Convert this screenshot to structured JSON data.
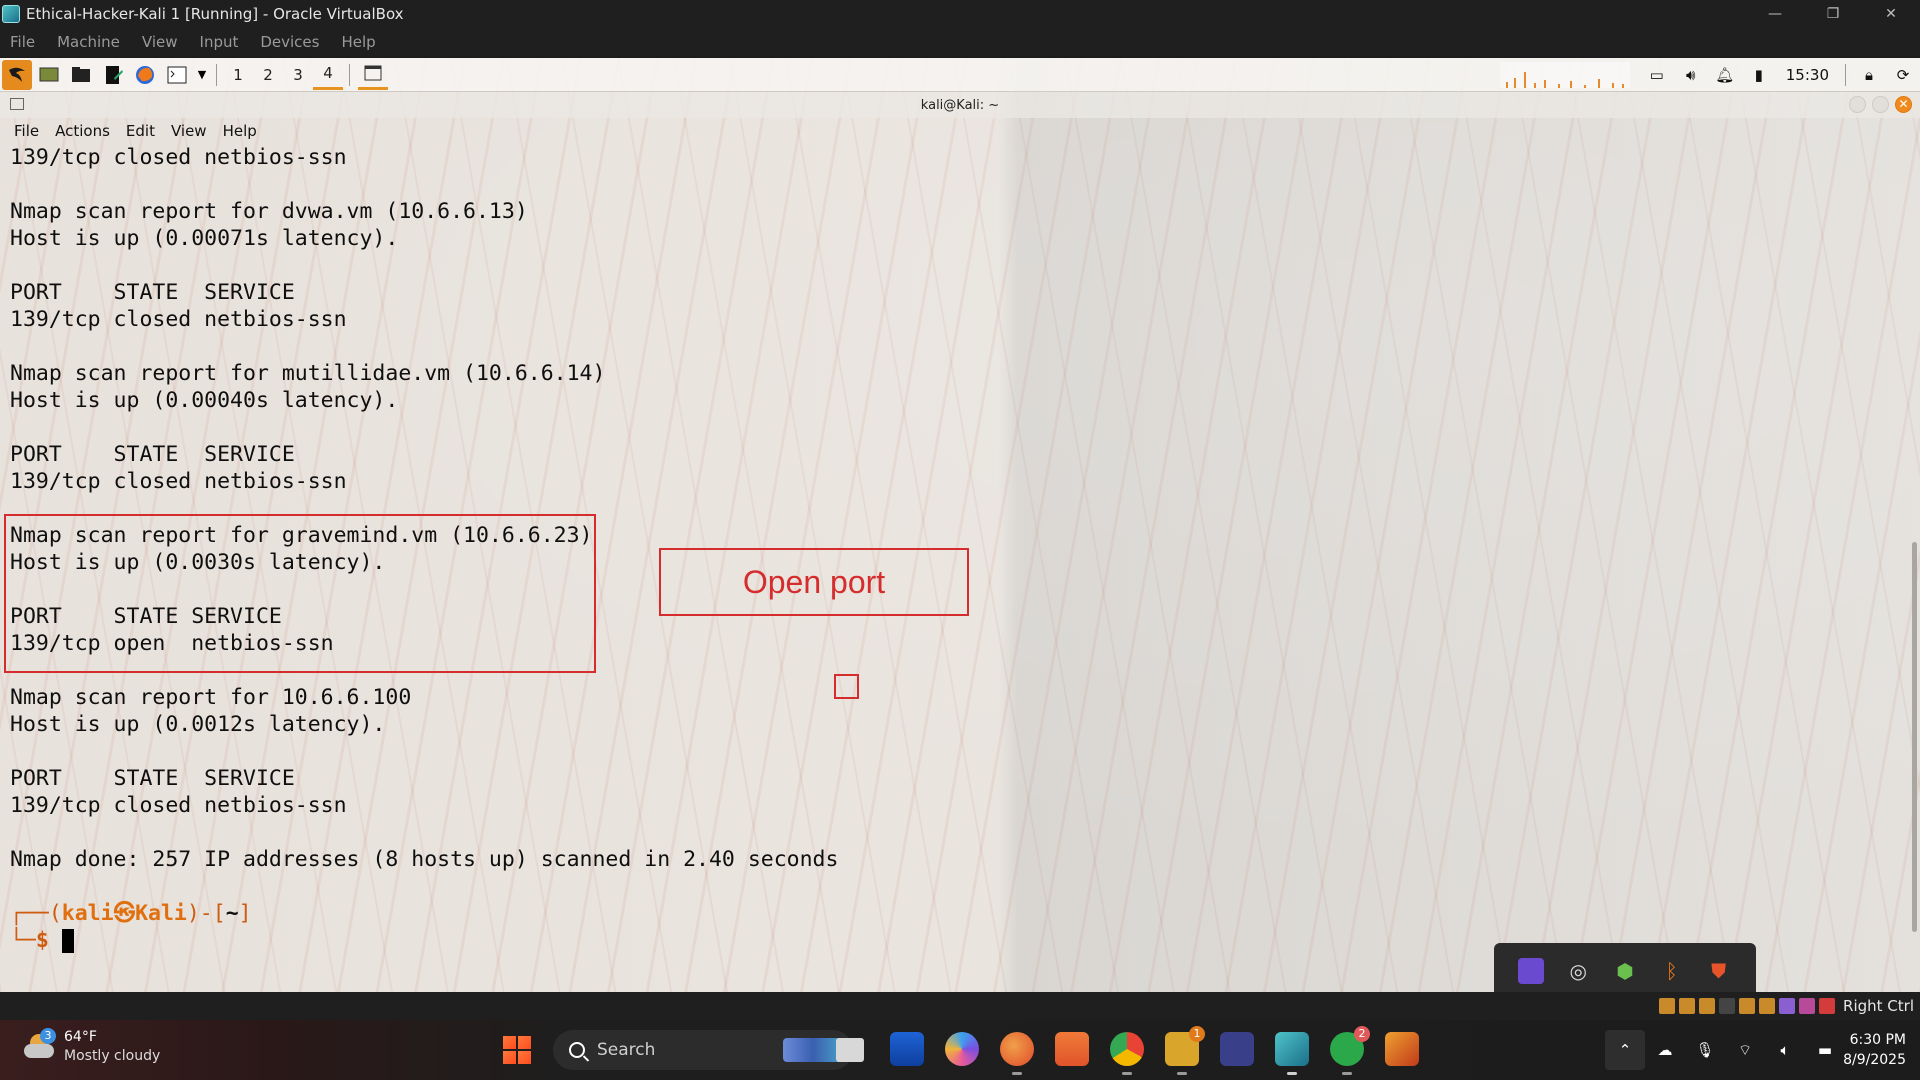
{
  "host_window": {
    "title": "Ethical-Hacker-Kali 1 [Running] - Oracle VirtualBox",
    "controls": [
      "—",
      "❐",
      "✕"
    ]
  },
  "host_menu": [
    "File",
    "Machine",
    "View",
    "Input",
    "Devices",
    "Help"
  ],
  "xfce_panel": {
    "workspaces": [
      "1",
      "2",
      "3",
      "4"
    ],
    "active_workspace": "4",
    "clock": "15:30"
  },
  "terminal": {
    "title": "kali@Kali: ~",
    "menu": [
      "File",
      "Actions",
      "Edit",
      "View",
      "Help"
    ],
    "lines": [
      "139/tcp closed netbios-ssn",
      "",
      "Nmap scan report for dvwa.vm (10.6.6.13)",
      "Host is up (0.00071s latency).",
      "",
      "PORT    STATE  SERVICE",
      "139/tcp closed netbios-ssn",
      "",
      "Nmap scan report for mutillidae.vm (10.6.6.14)",
      "Host is up (0.00040s latency).",
      "",
      "PORT    STATE  SERVICE",
      "139/tcp closed netbios-ssn",
      "",
      "Nmap scan report for gravemind.vm (10.6.6.23)",
      "Host is up (0.0030s latency).",
      "",
      "PORT    STATE SERVICE",
      "139/tcp open  netbios-ssn",
      "",
      "Nmap scan report for 10.6.6.100",
      "Host is up (0.0012s latency).",
      "",
      "PORT    STATE  SERVICE",
      "139/tcp closed netbios-ssn",
      "",
      "Nmap done: 257 IP addresses (8 hosts up) scanned in 2.40 seconds",
      ""
    ],
    "prompt": {
      "open": "┌──(",
      "user": "kali",
      "at": "㉿",
      "host": "Kali",
      "mid": ")-[",
      "dir": "~",
      "close": "]",
      "line2": "└─$ "
    }
  },
  "annotation": {
    "label": "Open port",
    "color": "#d52d2d"
  },
  "status_bar": {
    "host_key": "Right Ctrl"
  },
  "taskbar": {
    "weather_temp": "64°F",
    "weather_desc": "Mostly cloudy",
    "weather_badge": "3",
    "search_placeholder": "Search",
    "badge_teams": "1",
    "badge_whatsapp": "2",
    "time": "6:30 PM",
    "date": "8/9/2025"
  }
}
